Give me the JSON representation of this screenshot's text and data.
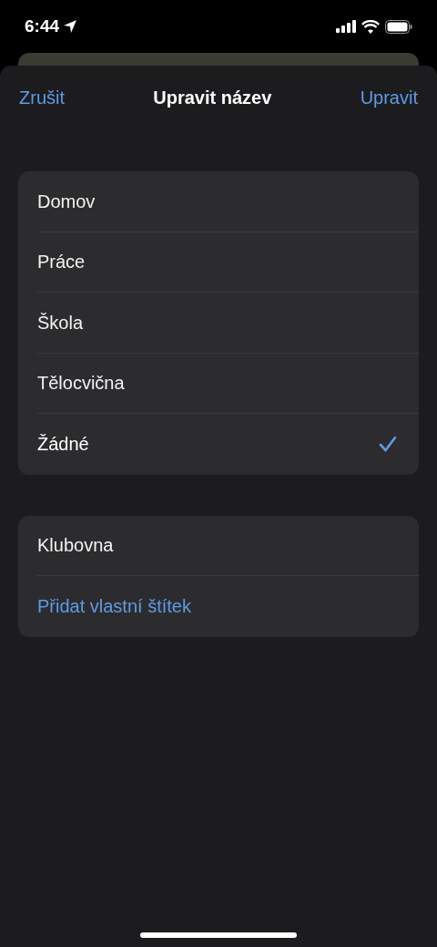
{
  "status_bar": {
    "time": "6:44"
  },
  "nav": {
    "cancel": "Zrušit",
    "title": "Upravit název",
    "action": "Upravit"
  },
  "groups": [
    {
      "items": [
        {
          "kind": "option",
          "label": "Domov",
          "selected": false
        },
        {
          "kind": "option",
          "label": "Práce",
          "selected": false
        },
        {
          "kind": "option",
          "label": "Škola",
          "selected": false
        },
        {
          "kind": "option",
          "label": "Tělocvična",
          "selected": false
        },
        {
          "kind": "option",
          "label": "Žádné",
          "selected": true
        }
      ]
    },
    {
      "items": [
        {
          "kind": "option",
          "label": "Klubovna",
          "selected": false
        },
        {
          "kind": "action",
          "label": "Přidat vlastní štítek"
        }
      ]
    }
  ]
}
